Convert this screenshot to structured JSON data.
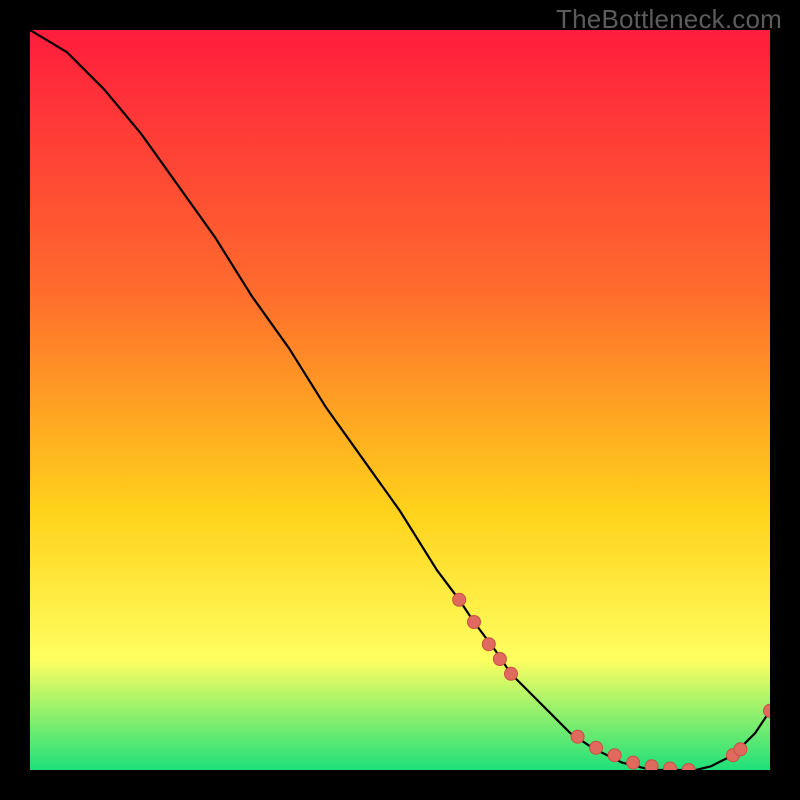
{
  "watermark": {
    "text": "TheBottleneck.com"
  },
  "colors": {
    "background": "#000000",
    "gradient_top": "#ff1d3d",
    "gradient_mid_high": "#ff6b2d",
    "gradient_mid": "#ffd21a",
    "gradient_low": "#ffff60",
    "gradient_bottom": "#1ee07a",
    "curve": "#000000",
    "marker_fill": "#e06a5e",
    "marker_stroke": "#c84f44"
  },
  "chart_data": {
    "type": "line",
    "title": "",
    "xlabel": "",
    "ylabel": "",
    "xlim": [
      0,
      100
    ],
    "ylim": [
      0,
      100
    ],
    "series": [
      {
        "name": "curve",
        "x": [
          0,
          5,
          10,
          15,
          20,
          25,
          30,
          35,
          40,
          45,
          50,
          55,
          58,
          60,
          63,
          65,
          68,
          70,
          73,
          76,
          80,
          84,
          88,
          90,
          92,
          95,
          98,
          100
        ],
        "y": [
          100,
          97,
          92,
          86,
          79,
          72,
          64,
          57,
          49,
          42,
          35,
          27,
          23,
          20,
          16,
          13,
          10,
          8,
          5,
          3,
          1,
          0,
          0,
          0,
          0.5,
          2,
          5,
          8
        ]
      }
    ],
    "markers": [
      {
        "name": "cluster-top-1",
        "x": 58,
        "y": 23
      },
      {
        "name": "cluster-top-2",
        "x": 60,
        "y": 20
      },
      {
        "name": "cluster-top-3",
        "x": 62,
        "y": 17
      },
      {
        "name": "cluster-top-4",
        "x": 63.5,
        "y": 15
      },
      {
        "name": "cluster-top-5",
        "x": 65,
        "y": 13
      },
      {
        "name": "cluster-bottom-1",
        "x": 74,
        "y": 4.5
      },
      {
        "name": "cluster-bottom-2",
        "x": 76.5,
        "y": 3
      },
      {
        "name": "cluster-bottom-3",
        "x": 79,
        "y": 2
      },
      {
        "name": "cluster-bottom-4",
        "x": 81.5,
        "y": 1
      },
      {
        "name": "cluster-bottom-5",
        "x": 84,
        "y": 0.5
      },
      {
        "name": "cluster-bottom-6",
        "x": 86.5,
        "y": 0.2
      },
      {
        "name": "cluster-bottom-7",
        "x": 89,
        "y": 0
      },
      {
        "name": "cluster-right-1",
        "x": 95,
        "y": 2
      },
      {
        "name": "cluster-right-2",
        "x": 96,
        "y": 2.8
      },
      {
        "name": "cluster-right-3",
        "x": 100,
        "y": 8
      }
    ]
  }
}
